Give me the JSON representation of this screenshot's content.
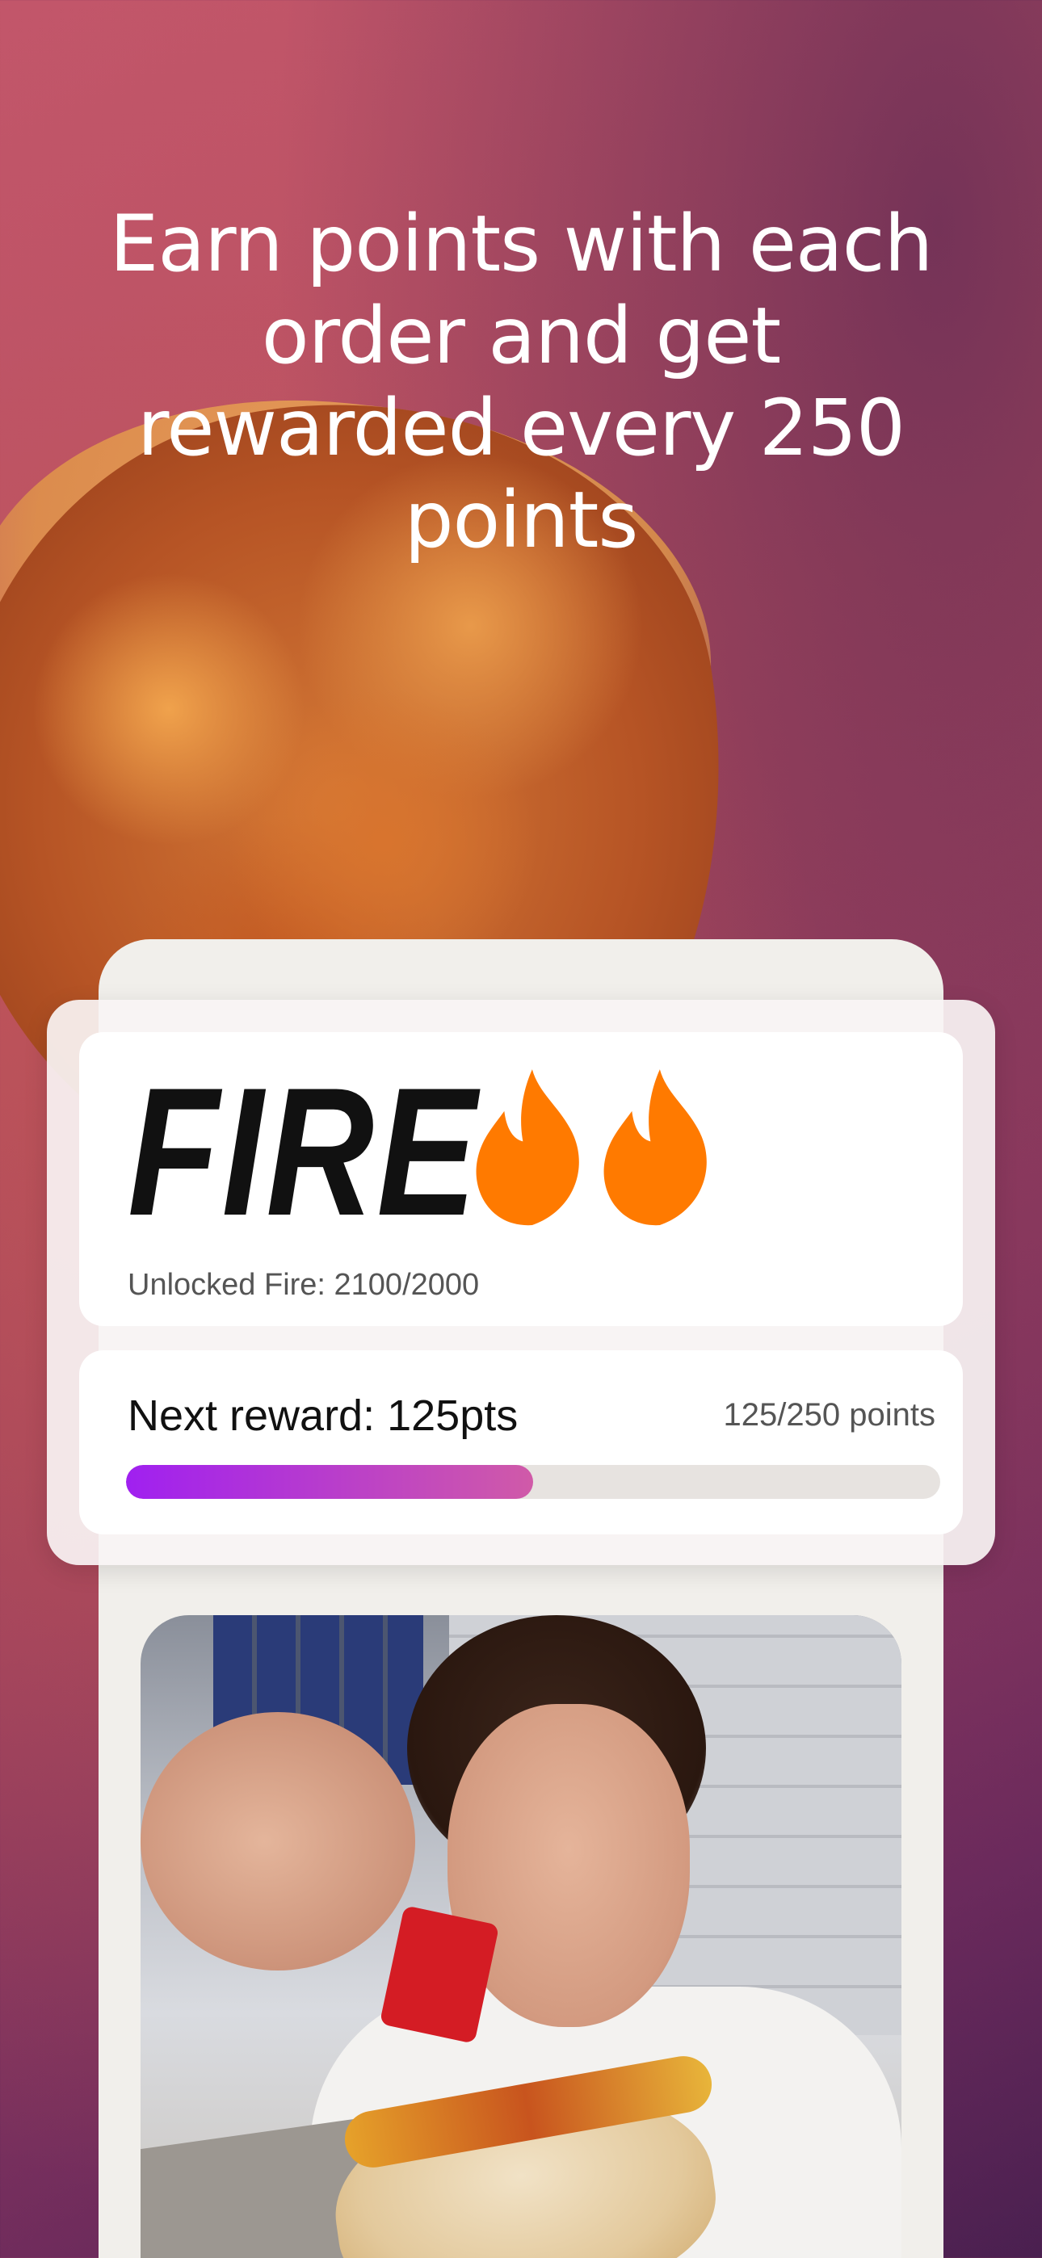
{
  "headline": "Earn points with each order and get rewarded every 250 points",
  "tier": {
    "name": "FIRE",
    "icon": "flame-icon",
    "flame_count": 2,
    "flame_color": "#ff7a00",
    "unlocked_text": "Unlocked Fire: 2100/2000"
  },
  "reward": {
    "next_reward_label": "Next reward: 125pts",
    "points_text": "125/250 points",
    "progress_fraction": 0.5,
    "progress_colors": [
      "#a020f0",
      "#d05aa8"
    ]
  },
  "colors": {
    "accent": "#a020f0",
    "background_top": "#c2566a",
    "background_bottom": "#4a2050"
  }
}
